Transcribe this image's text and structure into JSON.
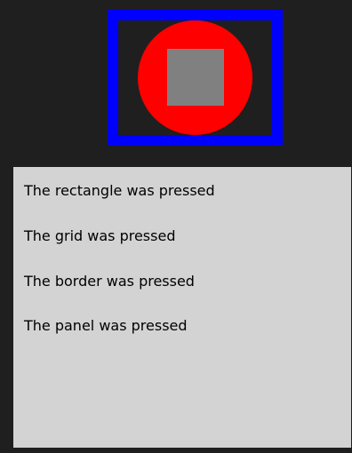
{
  "colors": {
    "background": "#1f1f1f",
    "border": "#0000ff",
    "ellipse": "#ff0000",
    "rectangle": "#808080",
    "log_panel": "#d3d3d3",
    "text": "#000000"
  },
  "messages": [
    "The rectangle was pressed",
    "The grid was pressed",
    "The border was pressed",
    "The panel was pressed"
  ]
}
